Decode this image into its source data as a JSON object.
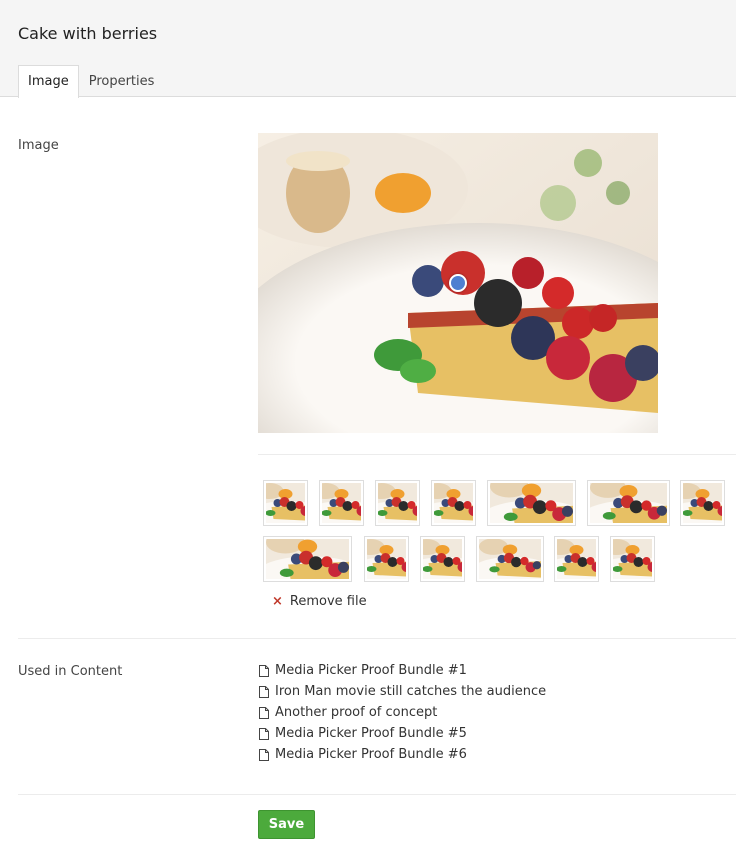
{
  "title": "Cake with berries",
  "tabs": [
    {
      "label": "Image",
      "active": true
    },
    {
      "label": "Properties",
      "active": false
    }
  ],
  "fields": {
    "image_label": "Image",
    "used_label": "Used in Content"
  },
  "remove_label": "Remove file",
  "used_in_content": [
    "Media Picker Proof Bundle #1",
    "Iron Man movie still catches the audience",
    "Another proof of concept",
    "Media Picker Proof Bundle #5",
    "Media Picker Proof Bundle #6"
  ],
  "save_label": "Save",
  "icons": {
    "focal_point": "focal-point-marker-icon",
    "remove": "remove-x-icon",
    "document": "document-icon"
  },
  "colors": {
    "accent": "#4f7fd1",
    "save": "#4caa3c",
    "remove": "#c0392b"
  }
}
